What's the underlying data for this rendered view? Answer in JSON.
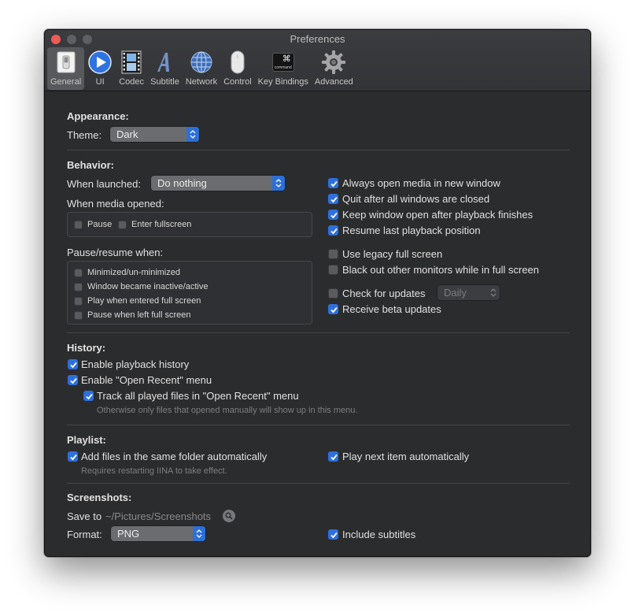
{
  "window": {
    "title": "Preferences"
  },
  "toolbar": {
    "items": [
      {
        "label": "General",
        "icon": "general-switch-icon"
      },
      {
        "label": "UI",
        "icon": "play-button-icon"
      },
      {
        "label": "Codec",
        "icon": "film-strip-icon"
      },
      {
        "label": "Subtitle",
        "icon": "letter-a-icon"
      },
      {
        "label": "Network",
        "icon": "globe-icon"
      },
      {
        "label": "Control",
        "icon": "mouse-icon"
      },
      {
        "label": "Key Bindings",
        "icon": "command-key-icon"
      },
      {
        "label": "Advanced",
        "icon": "gear-icon"
      }
    ],
    "command_key_caption": "command"
  },
  "appearance": {
    "title": "Appearance:",
    "theme_label": "Theme:",
    "theme_value": "Dark"
  },
  "behavior": {
    "title": "Behavior:",
    "when_launched_label": "When launched:",
    "when_launched_value": "Do nothing",
    "when_media_opened_label": "When media opened:",
    "pause_label": "Pause",
    "enter_fullscreen_label": "Enter fullscreen",
    "pause_resume_label": "Pause/resume when:",
    "minimized_label": "Minimized/un-minimized",
    "inactive_label": "Window became inactive/active",
    "play_fullscreen_label": "Play when entered full screen",
    "pause_fullscreen_label": "Pause when left full screen",
    "always_open_new_window": "Always open media in new window",
    "quit_after_closed": "Quit after all windows are closed",
    "keep_window_open": "Keep window open after playback finishes",
    "resume_last_position": "Resume last playback position",
    "legacy_fullscreen": "Use legacy full screen",
    "black_out_monitors": "Black out other monitors while in full screen",
    "check_updates": "Check for updates",
    "update_interval": "Daily",
    "beta_updates": "Receive beta updates"
  },
  "history": {
    "title": "History:",
    "enable_history": "Enable playback history",
    "enable_open_recent": "Enable \"Open Recent\" menu",
    "track_all_played": "Track all played files in \"Open Recent\" menu",
    "track_hint": "Otherwise only files that opened manually will show up in this menu."
  },
  "playlist": {
    "title": "Playlist:",
    "add_same_folder": "Add files in the same folder automatically",
    "add_hint": "Requires restarting IINA to take effect.",
    "play_next": "Play next item automatically"
  },
  "screenshots": {
    "title": "Screenshots:",
    "save_to_label": "Save to",
    "save_path": "~/Pictures/Screenshots",
    "format_label": "Format:",
    "format_value": "PNG",
    "include_subtitles": "Include subtitles"
  },
  "colors": {
    "accent": "#2e6fdc",
    "window_bg": "#2b2c2e",
    "close_button": "#ee5a55"
  }
}
